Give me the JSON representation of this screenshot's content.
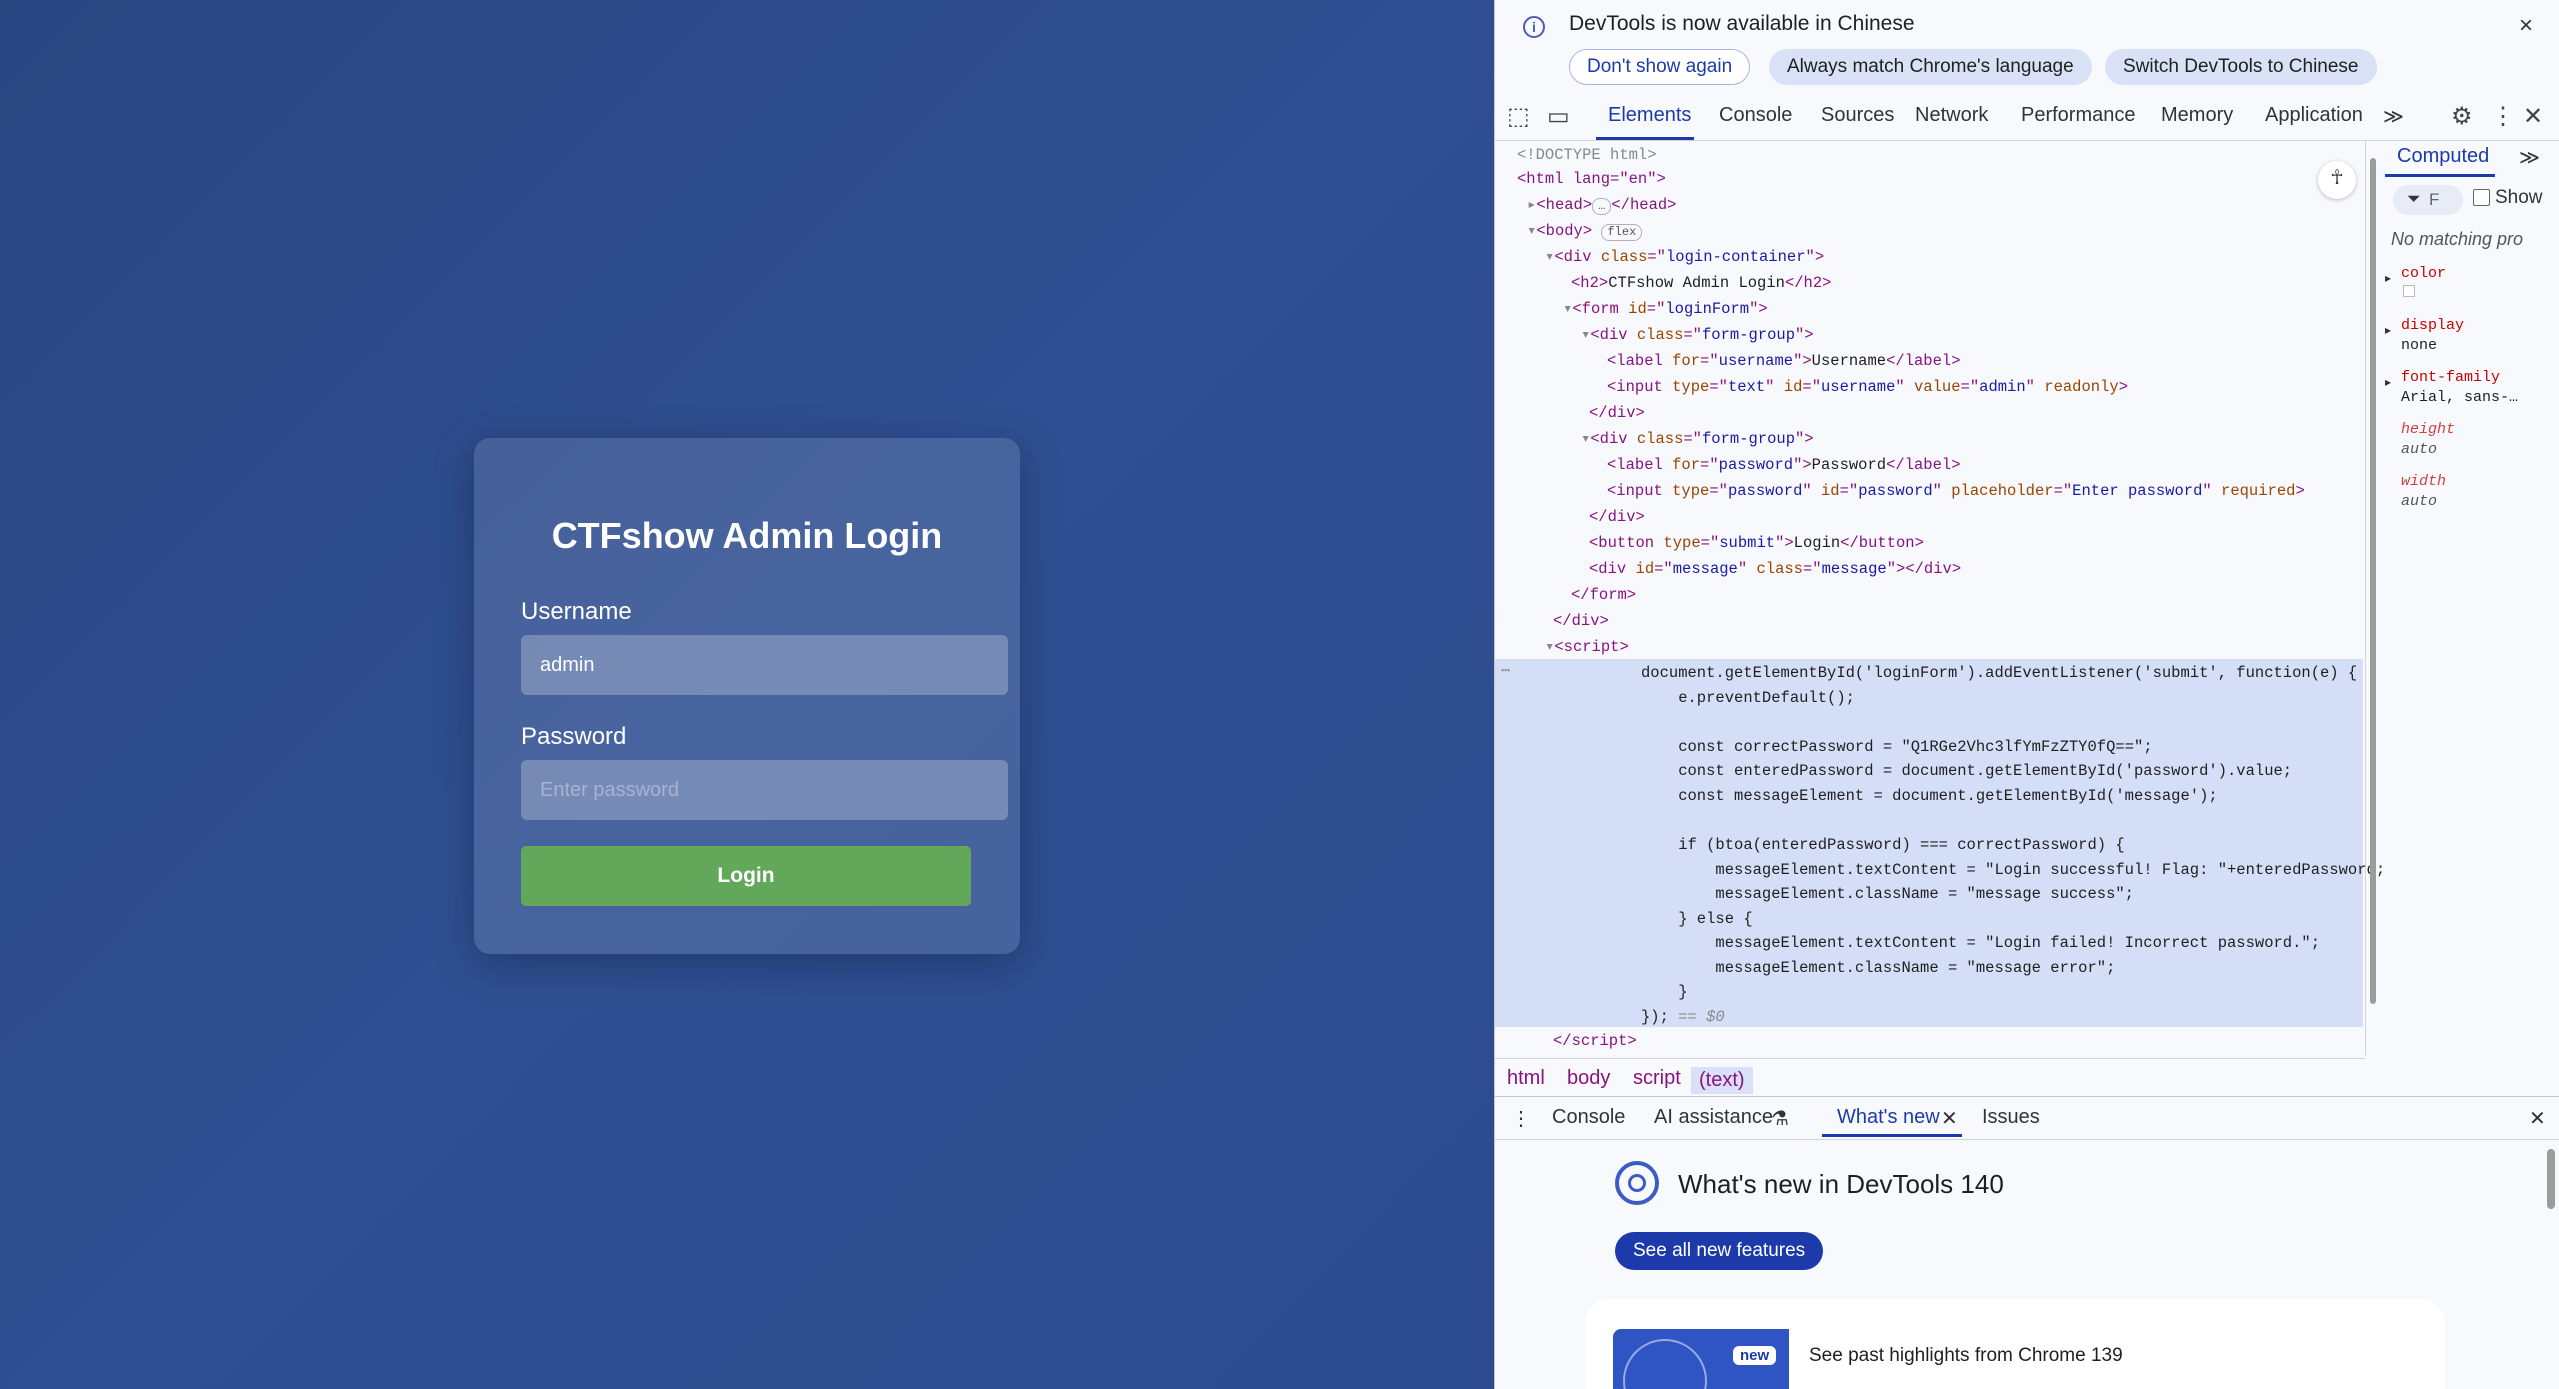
{
  "login": {
    "title": "CTFshow Admin Login",
    "username_label": "Username",
    "username_value": "admin",
    "password_label": "Password",
    "password_placeholder": "Enter password",
    "button_label": "Login"
  },
  "devtools": {
    "infobar": {
      "message": "DevTools is now available in Chinese",
      "dont_show": "Don't show again",
      "match_language": "Always match Chrome's language",
      "switch_language": "Switch DevTools to Chinese",
      "close": "×"
    },
    "tabs": [
      "Elements",
      "Console",
      "Sources",
      "Network",
      "Performance",
      "Memory",
      "Application"
    ],
    "more_tabs": "≫",
    "dom": {
      "doctype": "<!DOCTYPE html>",
      "html_open": "<html lang=\"en\">",
      "head": "<head>",
      "head_ellipsis": "…",
      "head_close": "</head>",
      "body": "<body>",
      "flex_badge": "flex",
      "h2_text": "CTFshow Admin Login",
      "label_username": "Username",
      "label_password": "Password",
      "button_text": "Login",
      "selected_marker": "== $0"
    },
    "script_lines": [
      "document.getElementById('loginForm').addEventListener('submit', function(e) {",
      "    e.preventDefault();",
      "",
      "    const correctPassword = \"Q1RGe2Vhc3lfYmFzZTY0fQ==\";",
      "    const enteredPassword = document.getElementById('password').value;",
      "    const messageElement = document.getElementById('message');",
      "",
      "    if (btoa(enteredPassword) === correctPassword) {",
      "        messageElement.textContent = \"Login successful! Flag: \"+enteredPassword;",
      "        messageElement.className = \"message success\";",
      "    } else {",
      "        messageElement.textContent = \"Login failed! Incorrect password.\";",
      "        messageElement.className = \"message error\";",
      "    }",
      "});"
    ],
    "breadcrumb": [
      "html",
      "body",
      "script",
      "(text)"
    ],
    "computed": {
      "tab": "Computed",
      "filter": "F",
      "show_label": "Show",
      "no_matching": "No matching pro",
      "props": [
        {
          "name": "color",
          "value": ""
        },
        {
          "name": "display",
          "value": "none"
        },
        {
          "name": "font-family",
          "value": "Arial, sans-…"
        },
        {
          "name": "height",
          "value": "auto"
        },
        {
          "name": "width",
          "value": "auto"
        }
      ]
    },
    "drawer": {
      "tabs": [
        "Console",
        "AI assistance",
        "What's new",
        "Issues"
      ],
      "whatsnew_title": "What's new in DevTools 140",
      "see_all": "See all new features",
      "new_badge": "new",
      "highlight": "See past highlights from Chrome 139"
    }
  }
}
